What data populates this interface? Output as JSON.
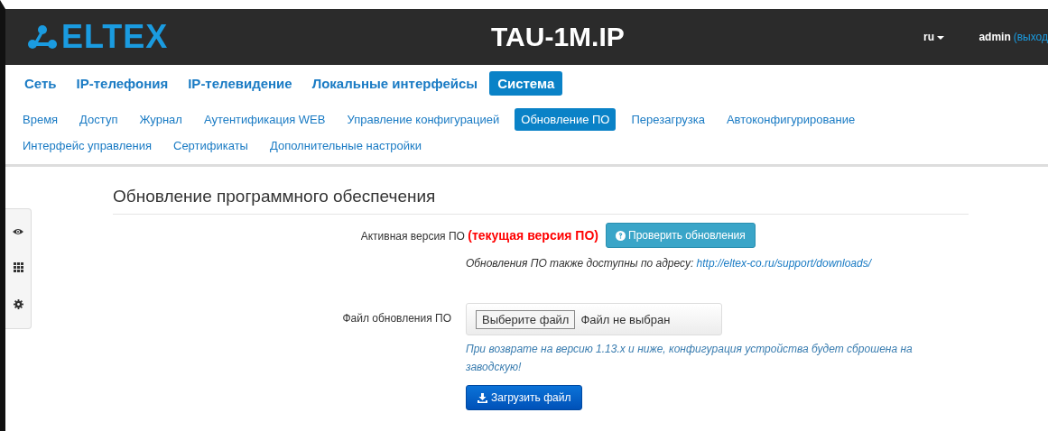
{
  "header": {
    "logo": "ELTEX",
    "title": "TAU-1M.IP",
    "language": "ru",
    "user": "admin",
    "logout": "(выход"
  },
  "main_tabs": [
    {
      "label": "Сеть",
      "selected": false
    },
    {
      "label": "IP-телефония",
      "selected": false
    },
    {
      "label": "IP-телевидение",
      "selected": false
    },
    {
      "label": "Локальные интерфейсы",
      "selected": false
    },
    {
      "label": "Система",
      "selected": true
    }
  ],
  "sub_tabs": [
    {
      "label": "Время",
      "selected": false
    },
    {
      "label": "Доступ",
      "selected": false
    },
    {
      "label": "Журнал",
      "selected": false
    },
    {
      "label": "Аутентификация WEB",
      "selected": false
    },
    {
      "label": "Управление конфигурацией",
      "selected": false
    },
    {
      "label": "Обновление ПО",
      "selected": true
    },
    {
      "label": "Перезагрузка",
      "selected": false
    },
    {
      "label": "Автоконфигурирование",
      "selected": false
    },
    {
      "label": "Интерфейс управления",
      "selected": false
    },
    {
      "label": "Сертификаты",
      "selected": false
    },
    {
      "label": "Дополнительные настройки",
      "selected": false
    }
  ],
  "page": {
    "title": "Обновление программного обеспечения",
    "active_version_label": "Активная версия ПО",
    "active_version_value": "(текущая версия ПО)",
    "check_button": "Проверить обновления",
    "hint": "Обновления ПО также доступны по адресу:",
    "hint_link": "http://eltex-co.ru/support/downloads/",
    "file_label": "Файл обновления ПО",
    "file_button": "Выберите файл",
    "file_status": "Файл не выбран",
    "warning": "При возврате на версию 1.13.x и ниже, конфигурация устройства будет сброшена на заводскую!",
    "upload_button": "Загрузить файл"
  }
}
